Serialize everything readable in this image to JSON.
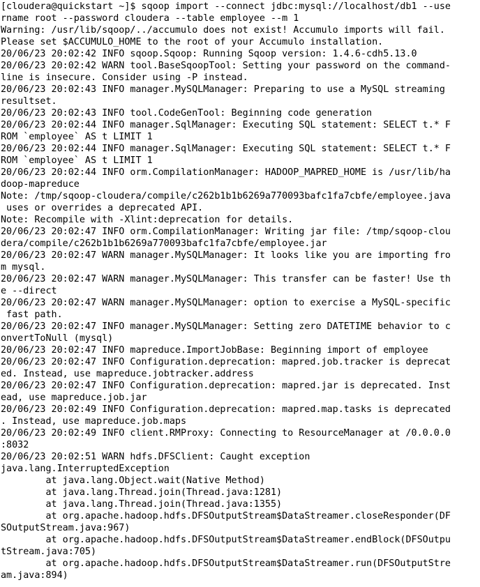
{
  "terminal": {
    "lines": [
      "[cloudera@quickstart ~]$ sqoop import --connect jdbc:mysql://localhost/db1 --use",
      "rname root --password cloudera --table employee --m 1",
      "Warning: /usr/lib/sqoop/../accumulo does not exist! Accumulo imports will fail.",
      "Please set $ACCUMULO_HOME to the root of your Accumulo installation.",
      "20/06/23 20:02:42 INFO sqoop.Sqoop: Running Sqoop version: 1.4.6-cdh5.13.0",
      "20/06/23 20:02:42 WARN tool.BaseSqoopTool: Setting your password on the command-",
      "line is insecure. Consider using -P instead.",
      "20/06/23 20:02:43 INFO manager.MySQLManager: Preparing to use a MySQL streaming",
      "resultset.",
      "20/06/23 20:02:43 INFO tool.CodeGenTool: Beginning code generation",
      "20/06/23 20:02:44 INFO manager.SqlManager: Executing SQL statement: SELECT t.* F",
      "ROM `employee` AS t LIMIT 1",
      "20/06/23 20:02:44 INFO manager.SqlManager: Executing SQL statement: SELECT t.* F",
      "ROM `employee` AS t LIMIT 1",
      "20/06/23 20:02:44 INFO orm.CompilationManager: HADOOP_MAPRED_HOME is /usr/lib/ha",
      "doop-mapreduce",
      "Note: /tmp/sqoop-cloudera/compile/c262b1b1b6269a770093bafc1fa7cbfe/employee.java",
      " uses or overrides a deprecated API.",
      "Note: Recompile with -Xlint:deprecation for details.",
      "20/06/23 20:02:47 INFO orm.CompilationManager: Writing jar file: /tmp/sqoop-clou",
      "dera/compile/c262b1b1b6269a770093bafc1fa7cbfe/employee.jar",
      "20/06/23 20:02:47 WARN manager.MySQLManager: It looks like you are importing fro",
      "m mysql.",
      "20/06/23 20:02:47 WARN manager.MySQLManager: This transfer can be faster! Use th",
      "e --direct",
      "20/06/23 20:02:47 WARN manager.MySQLManager: option to exercise a MySQL-specific",
      " fast path.",
      "20/06/23 20:02:47 INFO manager.MySQLManager: Setting zero DATETIME behavior to c",
      "onvertToNull (mysql)",
      "20/06/23 20:02:47 INFO mapreduce.ImportJobBase: Beginning import of employee",
      "20/06/23 20:02:47 INFO Configuration.deprecation: mapred.job.tracker is deprecat",
      "ed. Instead, use mapreduce.jobtracker.address",
      "20/06/23 20:02:47 INFO Configuration.deprecation: mapred.jar is deprecated. Inst",
      "ead, use mapreduce.job.jar",
      "20/06/23 20:02:49 INFO Configuration.deprecation: mapred.map.tasks is deprecated",
      ". Instead, use mapreduce.job.maps",
      "20/06/23 20:02:49 INFO client.RMProxy: Connecting to ResourceManager at /0.0.0.0",
      ":8032",
      "20/06/23 20:02:51 WARN hdfs.DFSClient: Caught exception",
      "java.lang.InterruptedException",
      "        at java.lang.Object.wait(Native Method)",
      "        at java.lang.Thread.join(Thread.java:1281)",
      "        at java.lang.Thread.join(Thread.java:1355)",
      "        at org.apache.hadoop.hdfs.DFSOutputStream$DataStreamer.closeResponder(DF",
      "SOutputStream.java:967)",
      "        at org.apache.hadoop.hdfs.DFSOutputStream$DataStreamer.endBlock(DFSOutpu",
      "tStream.java:705)",
      "        at org.apache.hadoop.hdfs.DFSOutputStream$DataStreamer.run(DFSOutputStre",
      "am.java:894)"
    ]
  }
}
